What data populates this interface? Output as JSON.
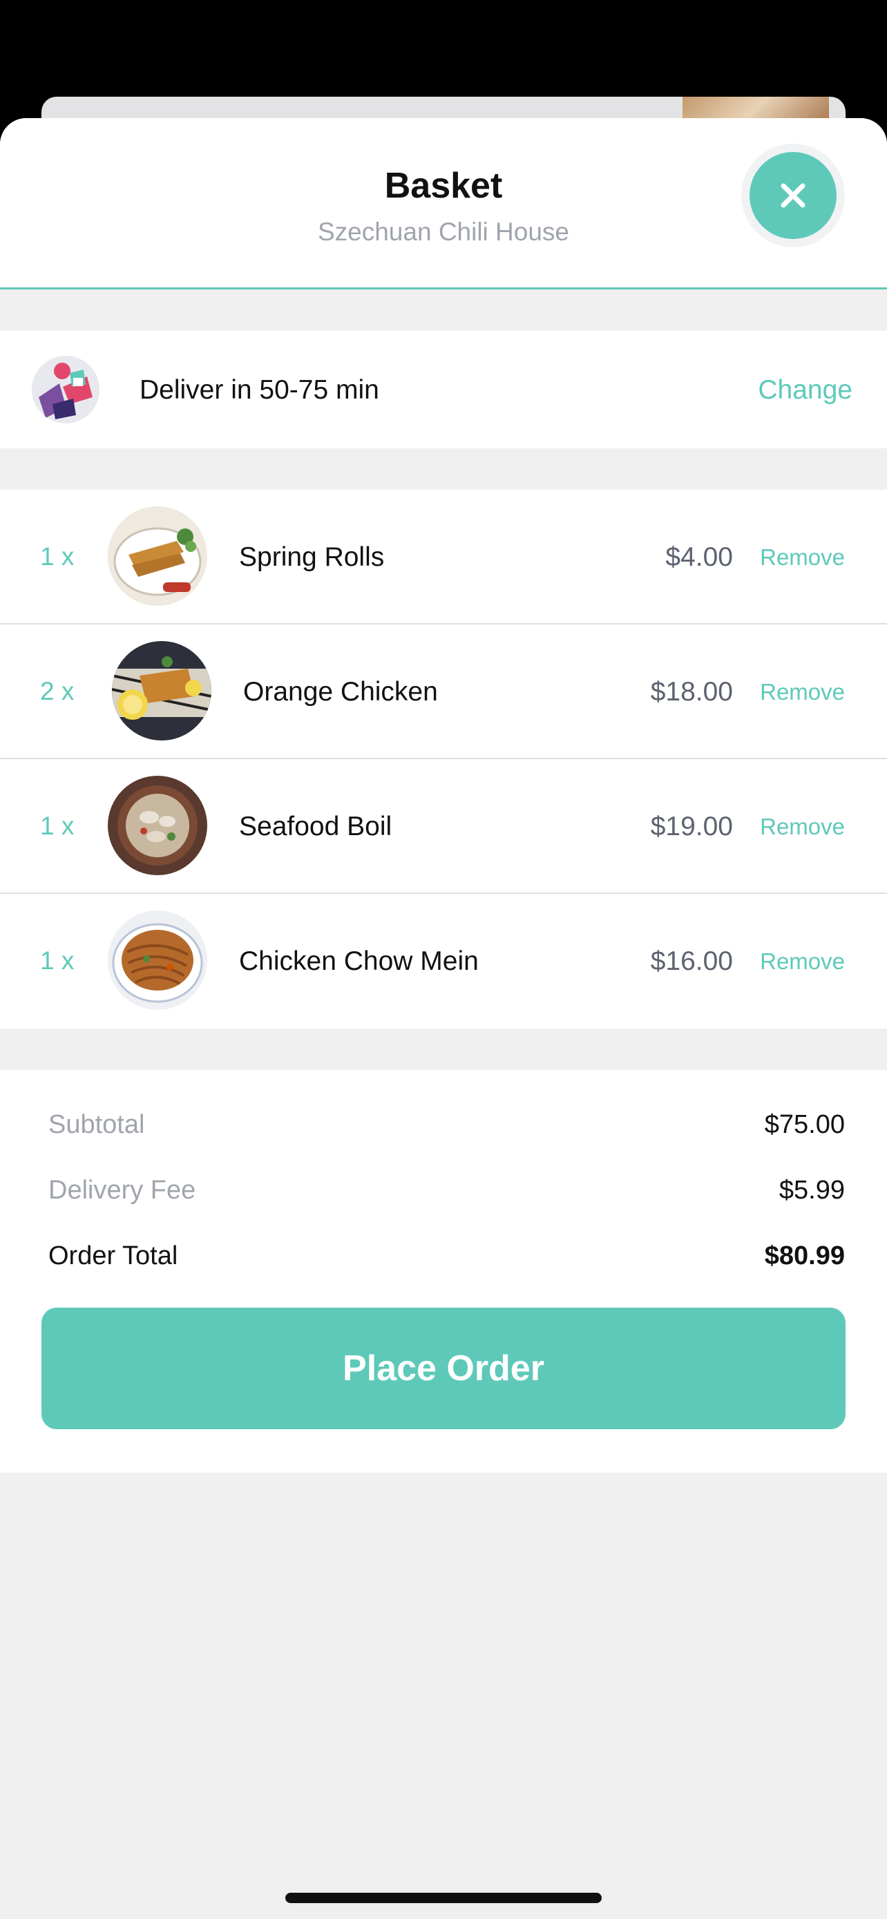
{
  "header": {
    "title": "Basket",
    "subtitle": "Szechuan Chili House",
    "close_icon": "close-x-icon"
  },
  "delivery": {
    "text": "Deliver in 50-75 min",
    "change_label": "Change",
    "icon": "delivery-rider-icon"
  },
  "items": [
    {
      "qty": "1 x",
      "name": "Spring Rolls",
      "price": "$4.00",
      "remove_label": "Remove"
    },
    {
      "qty": "2 x",
      "name": "Orange Chicken",
      "price": "$18.00",
      "remove_label": "Remove"
    },
    {
      "qty": "1 x",
      "name": "Seafood Boil",
      "price": "$19.00",
      "remove_label": "Remove"
    },
    {
      "qty": "1 x",
      "name": "Chicken Chow Mein",
      "price": "$16.00",
      "remove_label": "Remove"
    }
  ],
  "summary": {
    "subtotal_label": "Subtotal",
    "subtotal_value": "$75.00",
    "delivery_fee_label": "Delivery Fee",
    "delivery_fee_value": "$5.99",
    "total_label": "Order Total",
    "total_value": "$80.99"
  },
  "actions": {
    "place_order_label": "Place Order"
  },
  "colors": {
    "accent": "#5ec9b9",
    "muted_text": "#a0a4ad",
    "background": "#f0f0f1"
  }
}
